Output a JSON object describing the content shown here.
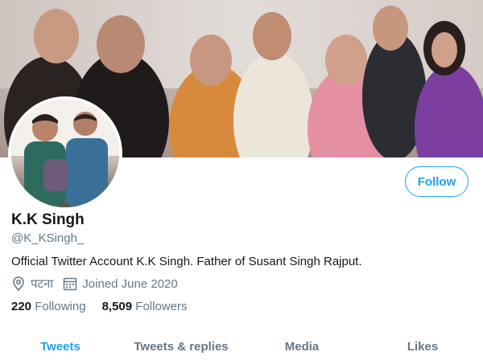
{
  "profile": {
    "name": "K.K Singh",
    "handle": "@K_KSingh_",
    "bio": "Official Twitter Account K.K Singh. Father of Susant Singh Rajput.",
    "location": "पटना",
    "joined": "Joined June 2020"
  },
  "stats": {
    "following_count": "220",
    "following_label": "Following",
    "followers_count": "8,509",
    "followers_label": "Followers"
  },
  "actions": {
    "follow_label": "Follow"
  },
  "tabs": [
    {
      "label": "Tweets",
      "active": true
    },
    {
      "label": "Tweets & replies",
      "active": false
    },
    {
      "label": "Media",
      "active": false
    },
    {
      "label": "Likes",
      "active": false
    }
  ],
  "icons": {
    "location": "location-pin-icon",
    "calendar": "calendar-icon"
  },
  "colors": {
    "accent": "#1da1f2",
    "secondary_text": "#657786",
    "primary_text": "#14171a"
  }
}
